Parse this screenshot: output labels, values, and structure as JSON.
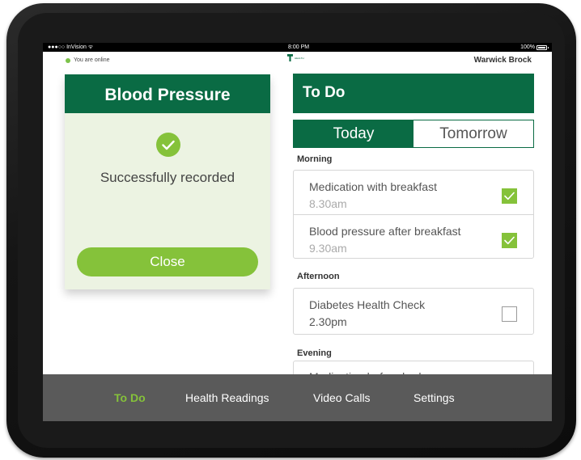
{
  "status_bar": {
    "carrier": "●●●○○ InVision ᯤ",
    "time": "8:00 PM",
    "battery": "100%"
  },
  "header": {
    "online_status": "You are online",
    "logo_text": "HEALTH",
    "user_name": "Warwick Brock"
  },
  "blood_pressure_card": {
    "title": "Blood Pressure",
    "message": "Successfully recorded",
    "close_label": "Close"
  },
  "todo": {
    "title": "To Do",
    "tabs": [
      {
        "label": "Today",
        "active": true
      },
      {
        "label": "Tomorrow",
        "active": false
      }
    ],
    "sections": [
      {
        "label": "Morning",
        "tasks": [
          {
            "title": "Medication with breakfast",
            "time": "8.30am",
            "done": true
          },
          {
            "title": "Blood pressure after breakfast",
            "time": "9.30am",
            "done": true
          }
        ]
      },
      {
        "label": "Afternoon",
        "tasks": [
          {
            "title": "Diabetes Health Check",
            "time": "2.30pm",
            "done": false
          }
        ]
      },
      {
        "label": "Evening",
        "tasks": [
          {
            "title": "Medication before bed",
            "time": "",
            "done": false
          }
        ]
      }
    ]
  },
  "bottom_nav": [
    {
      "label": "To Do",
      "active": true
    },
    {
      "label": "Health Readings",
      "active": false
    },
    {
      "label": "Video Calls",
      "active": false
    },
    {
      "label": "Settings",
      "active": false
    }
  ],
  "colors": {
    "brand_green": "#0a6b44",
    "accent_green": "#85c23a",
    "card_bg": "#ecf3e2",
    "nav_bg": "#5a5a5a"
  }
}
